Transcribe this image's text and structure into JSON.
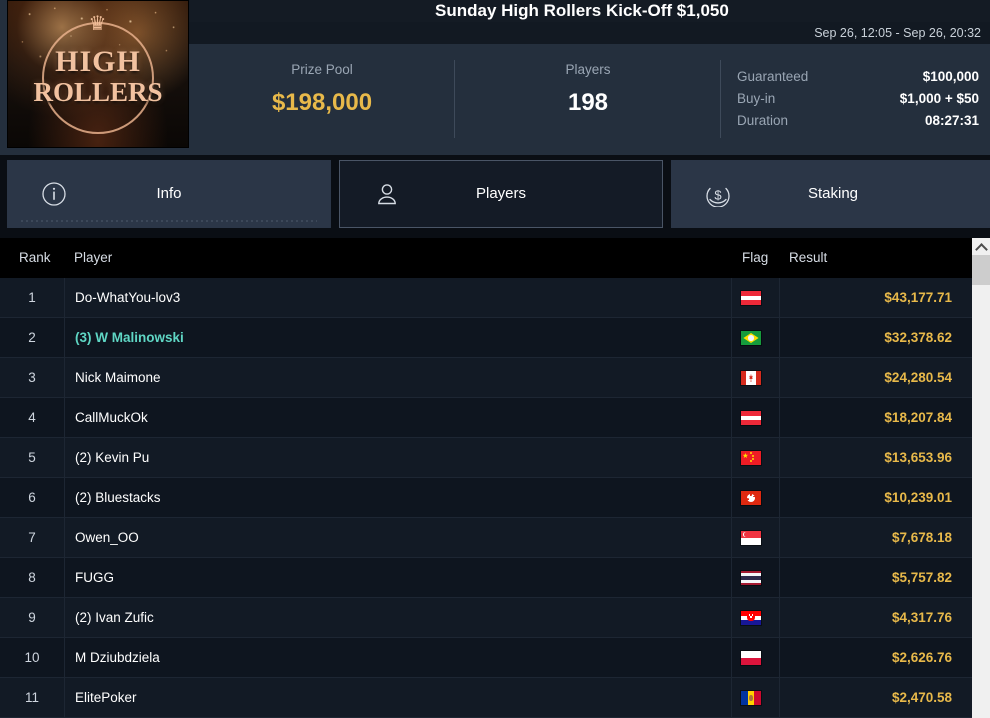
{
  "header": {
    "title": "Sunday High Rollers Kick-Off $1,050",
    "date_range": "Sep 26, 12:05 - Sep 26, 20:32",
    "logo": {
      "word1": "HIGH",
      "word2": "ROLLERS",
      "crown_glyph": "♛"
    },
    "stats": {
      "prize_pool_label": "Prize Pool",
      "prize_pool_value": "$198,000",
      "players_label": "Players",
      "players_value": "198",
      "details": [
        {
          "label": "Guaranteed",
          "value": "$100,000"
        },
        {
          "label": "Buy-in",
          "value": "$1,000 + $50"
        },
        {
          "label": "Duration",
          "value": "08:27:31"
        }
      ]
    }
  },
  "tabs": [
    {
      "label": "Info",
      "icon": "info-circle-icon",
      "active": false
    },
    {
      "label": "Players",
      "icon": "person-icon",
      "active": true
    },
    {
      "label": "Staking",
      "icon": "dollar-circle-icon",
      "active": false
    }
  ],
  "table": {
    "columns": [
      "Rank",
      "Player",
      "Flag",
      "Result"
    ],
    "rows": [
      {
        "rank": "1",
        "player": "Do-WhatYou-lov3",
        "flag": "austria-flag",
        "result": "$43,177.71",
        "highlighted": false
      },
      {
        "rank": "2",
        "player": "(3) W Malinowski",
        "flag": "brazil-flag",
        "result": "$32,378.62",
        "highlighted": true
      },
      {
        "rank": "3",
        "player": "Nick Maimone",
        "flag": "canada-flag",
        "result": "$24,280.54",
        "highlighted": false
      },
      {
        "rank": "4",
        "player": "CallMuckOk",
        "flag": "austria-flag",
        "result": "$18,207.84",
        "highlighted": false
      },
      {
        "rank": "5",
        "player": "(2) Kevin Pu",
        "flag": "china-flag",
        "result": "$13,653.96",
        "highlighted": false
      },
      {
        "rank": "6",
        "player": "(2) Bluestacks",
        "flag": "hongkong-flag",
        "result": "$10,239.01",
        "highlighted": false
      },
      {
        "rank": "7",
        "player": "Owen_OO",
        "flag": "singapore-flag",
        "result": "$7,678.18",
        "highlighted": false
      },
      {
        "rank": "8",
        "player": "FUGG",
        "flag": "thailand-flag",
        "result": "$5,757.82",
        "highlighted": false
      },
      {
        "rank": "9",
        "player": "(2) Ivan Zufic",
        "flag": "croatia-flag",
        "result": "$4,317.76",
        "highlighted": false
      },
      {
        "rank": "10",
        "player": "M Dziubdziela",
        "flag": "poland-flag",
        "result": "$2,626.76",
        "highlighted": false
      },
      {
        "rank": "11",
        "player": "ElitePoker",
        "flag": "moldova-flag",
        "result": "$2,470.58",
        "highlighted": false
      }
    ]
  },
  "scrollbar": {
    "up_arrow": "chevron-up-icon"
  },
  "colors": {
    "accent_amber": "#e8b94a",
    "highlight_teal": "#5fd6c4",
    "header_bg": "#242f3d",
    "tab_active_bg": "#141b26",
    "row_bg": "#121a25"
  }
}
